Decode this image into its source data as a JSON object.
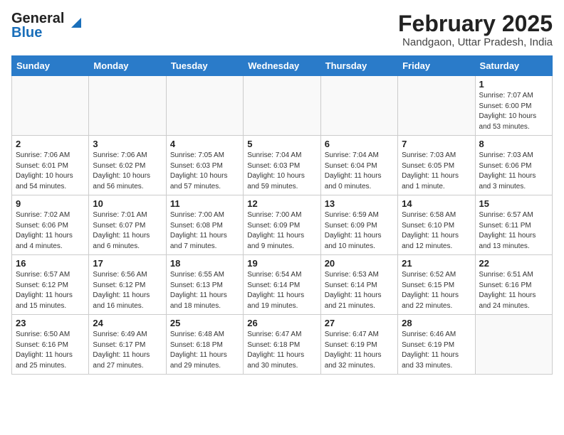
{
  "header": {
    "logo_general": "General",
    "logo_blue": "Blue",
    "month_title": "February 2025",
    "location": "Nandgaon, Uttar Pradesh, India"
  },
  "weekdays": [
    "Sunday",
    "Monday",
    "Tuesday",
    "Wednesday",
    "Thursday",
    "Friday",
    "Saturday"
  ],
  "weeks": [
    [
      {
        "day": "",
        "info": ""
      },
      {
        "day": "",
        "info": ""
      },
      {
        "day": "",
        "info": ""
      },
      {
        "day": "",
        "info": ""
      },
      {
        "day": "",
        "info": ""
      },
      {
        "day": "",
        "info": ""
      },
      {
        "day": "1",
        "info": "Sunrise: 7:07 AM\nSunset: 6:00 PM\nDaylight: 10 hours\nand 53 minutes."
      }
    ],
    [
      {
        "day": "2",
        "info": "Sunrise: 7:06 AM\nSunset: 6:01 PM\nDaylight: 10 hours\nand 54 minutes."
      },
      {
        "day": "3",
        "info": "Sunrise: 7:06 AM\nSunset: 6:02 PM\nDaylight: 10 hours\nand 56 minutes."
      },
      {
        "day": "4",
        "info": "Sunrise: 7:05 AM\nSunset: 6:03 PM\nDaylight: 10 hours\nand 57 minutes."
      },
      {
        "day": "5",
        "info": "Sunrise: 7:04 AM\nSunset: 6:03 PM\nDaylight: 10 hours\nand 59 minutes."
      },
      {
        "day": "6",
        "info": "Sunrise: 7:04 AM\nSunset: 6:04 PM\nDaylight: 11 hours\nand 0 minutes."
      },
      {
        "day": "7",
        "info": "Sunrise: 7:03 AM\nSunset: 6:05 PM\nDaylight: 11 hours\nand 1 minute."
      },
      {
        "day": "8",
        "info": "Sunrise: 7:03 AM\nSunset: 6:06 PM\nDaylight: 11 hours\nand 3 minutes."
      }
    ],
    [
      {
        "day": "9",
        "info": "Sunrise: 7:02 AM\nSunset: 6:06 PM\nDaylight: 11 hours\nand 4 minutes."
      },
      {
        "day": "10",
        "info": "Sunrise: 7:01 AM\nSunset: 6:07 PM\nDaylight: 11 hours\nand 6 minutes."
      },
      {
        "day": "11",
        "info": "Sunrise: 7:00 AM\nSunset: 6:08 PM\nDaylight: 11 hours\nand 7 minutes."
      },
      {
        "day": "12",
        "info": "Sunrise: 7:00 AM\nSunset: 6:09 PM\nDaylight: 11 hours\nand 9 minutes."
      },
      {
        "day": "13",
        "info": "Sunrise: 6:59 AM\nSunset: 6:09 PM\nDaylight: 11 hours\nand 10 minutes."
      },
      {
        "day": "14",
        "info": "Sunrise: 6:58 AM\nSunset: 6:10 PM\nDaylight: 11 hours\nand 12 minutes."
      },
      {
        "day": "15",
        "info": "Sunrise: 6:57 AM\nSunset: 6:11 PM\nDaylight: 11 hours\nand 13 minutes."
      }
    ],
    [
      {
        "day": "16",
        "info": "Sunrise: 6:57 AM\nSunset: 6:12 PM\nDaylight: 11 hours\nand 15 minutes."
      },
      {
        "day": "17",
        "info": "Sunrise: 6:56 AM\nSunset: 6:12 PM\nDaylight: 11 hours\nand 16 minutes."
      },
      {
        "day": "18",
        "info": "Sunrise: 6:55 AM\nSunset: 6:13 PM\nDaylight: 11 hours\nand 18 minutes."
      },
      {
        "day": "19",
        "info": "Sunrise: 6:54 AM\nSunset: 6:14 PM\nDaylight: 11 hours\nand 19 minutes."
      },
      {
        "day": "20",
        "info": "Sunrise: 6:53 AM\nSunset: 6:14 PM\nDaylight: 11 hours\nand 21 minutes."
      },
      {
        "day": "21",
        "info": "Sunrise: 6:52 AM\nSunset: 6:15 PM\nDaylight: 11 hours\nand 22 minutes."
      },
      {
        "day": "22",
        "info": "Sunrise: 6:51 AM\nSunset: 6:16 PM\nDaylight: 11 hours\nand 24 minutes."
      }
    ],
    [
      {
        "day": "23",
        "info": "Sunrise: 6:50 AM\nSunset: 6:16 PM\nDaylight: 11 hours\nand 25 minutes."
      },
      {
        "day": "24",
        "info": "Sunrise: 6:49 AM\nSunset: 6:17 PM\nDaylight: 11 hours\nand 27 minutes."
      },
      {
        "day": "25",
        "info": "Sunrise: 6:48 AM\nSunset: 6:18 PM\nDaylight: 11 hours\nand 29 minutes."
      },
      {
        "day": "26",
        "info": "Sunrise: 6:47 AM\nSunset: 6:18 PM\nDaylight: 11 hours\nand 30 minutes."
      },
      {
        "day": "27",
        "info": "Sunrise: 6:47 AM\nSunset: 6:19 PM\nDaylight: 11 hours\nand 32 minutes."
      },
      {
        "day": "28",
        "info": "Sunrise: 6:46 AM\nSunset: 6:19 PM\nDaylight: 11 hours\nand 33 minutes."
      },
      {
        "day": "",
        "info": ""
      }
    ]
  ]
}
